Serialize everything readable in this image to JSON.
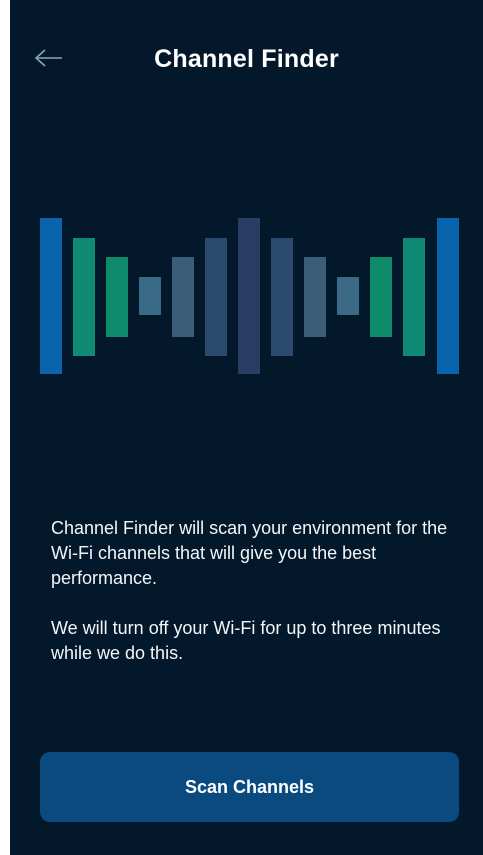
{
  "header": {
    "title": "Channel Finder",
    "back_icon": "arrow-left-icon"
  },
  "illustration": {
    "icon": "channel-bars-icon",
    "colors": {
      "blue": "#0a63ad",
      "teal": "#0f8a75",
      "green": "#0e8b6a",
      "slate": "#3b5d78",
      "navy": "#273d62"
    }
  },
  "body": {
    "paragraph_1": "Channel Finder will scan your environment for the Wi-Fi channels that will give you the best performance.",
    "paragraph_2": "We will turn off your Wi-Fi for up to three minutes while we do this."
  },
  "actions": {
    "scan_label": "Scan Channels"
  },
  "colors": {
    "background": "#03182b",
    "button": "#0a4a7f",
    "text": "#ffffff"
  }
}
